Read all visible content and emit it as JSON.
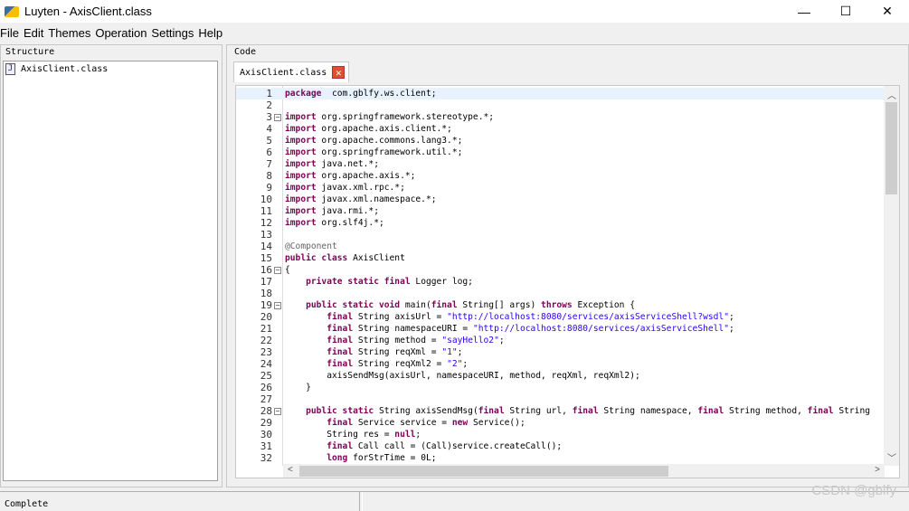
{
  "window": {
    "title": "Luyten - AxisClient.class",
    "minimize": "—",
    "maximize": "☐",
    "close": "✕"
  },
  "menu": [
    "File",
    "Edit",
    "Themes",
    "Operation",
    "Settings",
    "Help"
  ],
  "structure": {
    "label": "Structure",
    "items": [
      {
        "icon": "java-file-icon",
        "label": "AxisClient.class"
      }
    ]
  },
  "code_panel": {
    "label": "Code",
    "tab": "AxisClient.class",
    "tab_close": "✕"
  },
  "code": {
    "current_line": 1,
    "folds": [
      3,
      16,
      19,
      28
    ],
    "lines": [
      [
        [
          "kw",
          "package"
        ],
        [
          "",
          "  com.gblfy.ws.client;"
        ]
      ],
      [],
      [
        [
          "kw",
          "import"
        ],
        [
          "",
          " org.springframework.stereotype.*;"
        ]
      ],
      [
        [
          "kw",
          "import"
        ],
        [
          "",
          " org.apache.axis.client.*;"
        ]
      ],
      [
        [
          "kw",
          "import"
        ],
        [
          "",
          " org.apache.commons.lang3.*;"
        ]
      ],
      [
        [
          "kw",
          "import"
        ],
        [
          "",
          " org.springframework.util.*;"
        ]
      ],
      [
        [
          "kw",
          "import"
        ],
        [
          "",
          " java.net.*;"
        ]
      ],
      [
        [
          "kw",
          "import"
        ],
        [
          "",
          " org.apache.axis.*;"
        ]
      ],
      [
        [
          "kw",
          "import"
        ],
        [
          "",
          " javax.xml.rpc.*;"
        ]
      ],
      [
        [
          "kw",
          "import"
        ],
        [
          "",
          " javax.xml.namespace.*;"
        ]
      ],
      [
        [
          "kw",
          "import"
        ],
        [
          "",
          " java.rmi.*;"
        ]
      ],
      [
        [
          "kw",
          "import"
        ],
        [
          "",
          " org.slf4j.*;"
        ]
      ],
      [],
      [
        [
          "ann",
          "@Component"
        ]
      ],
      [
        [
          "kw",
          "public class"
        ],
        [
          "",
          " AxisClient"
        ]
      ],
      [
        [
          "",
          "{"
        ]
      ],
      [
        [
          "",
          "    "
        ],
        [
          "kw",
          "private static final"
        ],
        [
          "",
          " Logger log;"
        ]
      ],
      [],
      [
        [
          "",
          "    "
        ],
        [
          "kw",
          "public static void"
        ],
        [
          "",
          " main("
        ],
        [
          "kw",
          "final"
        ],
        [
          "",
          " String[] args) "
        ],
        [
          "kw",
          "throws"
        ],
        [
          "",
          " Exception {"
        ]
      ],
      [
        [
          "",
          "        "
        ],
        [
          "kw",
          "final"
        ],
        [
          "",
          " String axisUrl = "
        ],
        [
          "str",
          "\"http://localhost:8080/services/axisServiceShell?wsdl\""
        ],
        [
          "",
          ";"
        ]
      ],
      [
        [
          "",
          "        "
        ],
        [
          "kw",
          "final"
        ],
        [
          "",
          " String namespaceURI = "
        ],
        [
          "str",
          "\"http://localhost:8080/services/axisServiceShell\""
        ],
        [
          "",
          ";"
        ]
      ],
      [
        [
          "",
          "        "
        ],
        [
          "kw",
          "final"
        ],
        [
          "",
          " String method = "
        ],
        [
          "str",
          "\"sayHello2\""
        ],
        [
          "",
          ";"
        ]
      ],
      [
        [
          "",
          "        "
        ],
        [
          "kw",
          "final"
        ],
        [
          "",
          " String reqXml = "
        ],
        [
          "str",
          "\"1\""
        ],
        [
          "",
          ";"
        ]
      ],
      [
        [
          "",
          "        "
        ],
        [
          "kw",
          "final"
        ],
        [
          "",
          " String reqXml2 = "
        ],
        [
          "str",
          "\"2\""
        ],
        [
          "",
          ";"
        ]
      ],
      [
        [
          "",
          "        axisSendMsg(axisUrl, namespaceURI, method, reqXml, reqXml2);"
        ]
      ],
      [
        [
          "",
          "    }"
        ]
      ],
      [],
      [
        [
          "",
          "    "
        ],
        [
          "kw",
          "public static"
        ],
        [
          "",
          " String axisSendMsg("
        ],
        [
          "kw",
          "final"
        ],
        [
          "",
          " String url, "
        ],
        [
          "kw",
          "final"
        ],
        [
          "",
          " String namespace, "
        ],
        [
          "kw",
          "final"
        ],
        [
          "",
          " String method, "
        ],
        [
          "kw",
          "final"
        ],
        [
          "",
          " String"
        ]
      ],
      [
        [
          "",
          "        "
        ],
        [
          "kw",
          "final"
        ],
        [
          "",
          " Service service = "
        ],
        [
          "kw",
          "new"
        ],
        [
          "",
          " Service();"
        ]
      ],
      [
        [
          "",
          "        String res = "
        ],
        [
          "kw",
          "null"
        ],
        [
          "",
          ";"
        ]
      ],
      [
        [
          "",
          "        "
        ],
        [
          "kw",
          "final"
        ],
        [
          "",
          " Call call = (Call)service.createCall();"
        ]
      ],
      [
        [
          "",
          "        "
        ],
        [
          "kw",
          "long"
        ],
        [
          "",
          " forStrTime = 0L;"
        ]
      ]
    ]
  },
  "status": {
    "text": "Complete"
  },
  "watermark": "CSDN @gblfy"
}
